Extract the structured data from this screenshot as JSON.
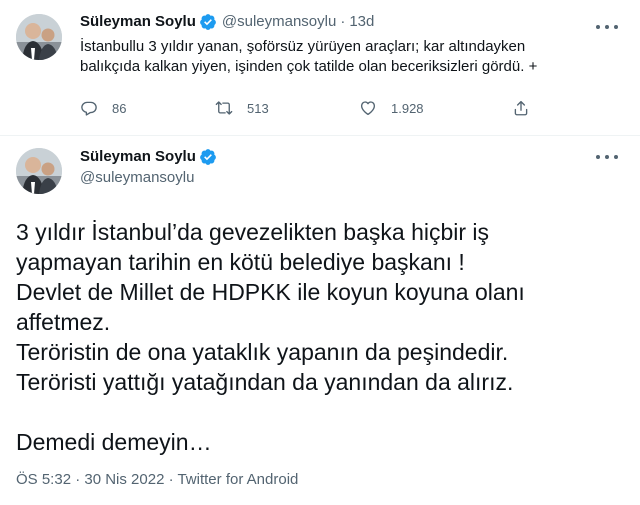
{
  "colors": {
    "verified": "#1d9bf0",
    "text": "#0f1419",
    "secondary": "#536471",
    "divider": "#eff3f4"
  },
  "tweet1": {
    "author_name": "Süleyman Soylu",
    "handle": "@suleymansoylu",
    "separator": "·",
    "time": "13d",
    "text_lines": [
      "İstanbullu 3 yıldır yanan, şoförsüz yürüyen araçları; kar altındayken",
      "balıkçıda kalkan yiyen, işinden çok tatilde olan beceriksizleri gördü. +"
    ],
    "actions": {
      "reply_icon": "reply-icon",
      "reply_count": "86",
      "retweet_icon": "retweet-icon",
      "retweet_count": "513",
      "like_icon": "heart-icon",
      "like_count": "1.928",
      "share_icon": "share-icon"
    },
    "more_icon": "more-options-icon"
  },
  "tweet2": {
    "author_name": "Süleyman Soylu",
    "handle": "@suleymansoylu",
    "more_icon": "more-options-icon",
    "body_lines": [
      "3 yıldır İstanbul’da gevezelikten başka hiçbir iş",
      "yapmayan tarihin en kötü belediye başkanı !",
      "Devlet de Millet de HDPKK ile koyun koyuna olanı",
      "affetmez.",
      "Teröristin de ona yataklık yapanın da peşindedir.",
      "Teröristi yattığı yatağından da yanından da alırız."
    ],
    "closing_line": "Demedi demeyin…",
    "meta": "ÖS 5:32 · 30 Nis 2022 · Twitter for Android"
  }
}
